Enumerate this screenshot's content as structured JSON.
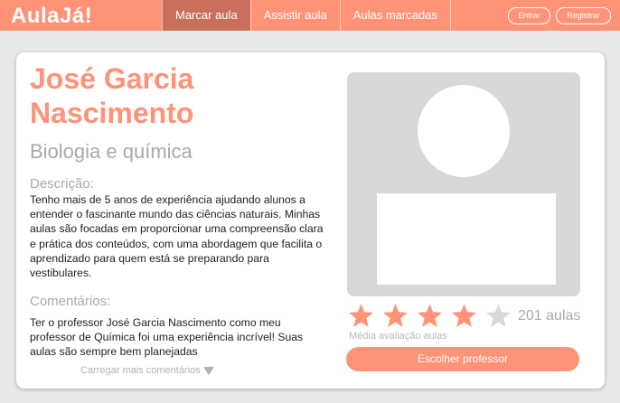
{
  "header": {
    "logo": "AulaJá!",
    "nav": [
      {
        "label": "Marcar aula",
        "active": true
      },
      {
        "label": "Assistir aula",
        "active": false
      },
      {
        "label": "Aulas marcadas",
        "active": false
      }
    ],
    "login_label": "Entrar",
    "register_label": "Registrar"
  },
  "profile": {
    "name": "José Garcia Nascimento",
    "subject": "Biologia e química",
    "description_label": "Descrição:",
    "description": "Tenho mais de 5 anos de experiência ajudando alunos a entender o fascinante mundo das ciências naturais. Minhas aulas são focadas em proporcionar uma compreensão clara e prática dos conteúdos, com uma abordagem que facilita o aprendizado para quem está se preparando para vestibulares.",
    "comments_label": "Comentários:",
    "comment": "Ter o professor José Garcia Nascimento como meu professor de Química foi uma experiência incrível! Suas aulas são sempre bem planejadas",
    "load_more_label": "Carregar mais comentários"
  },
  "rating": {
    "stars": 4,
    "max_stars": 5,
    "classes_count": "201 aulas",
    "caption": "Média avaliação aulas"
  },
  "choose_button_label": "Escolher professor",
  "colors": {
    "accent": "#ff9377",
    "nav_active": "#c9705c",
    "muted_text": "#a9a9a9",
    "star_empty": "#d9d9d9"
  },
  "icons": {
    "star": "star-icon",
    "load_more": "triangle-down-icon"
  }
}
